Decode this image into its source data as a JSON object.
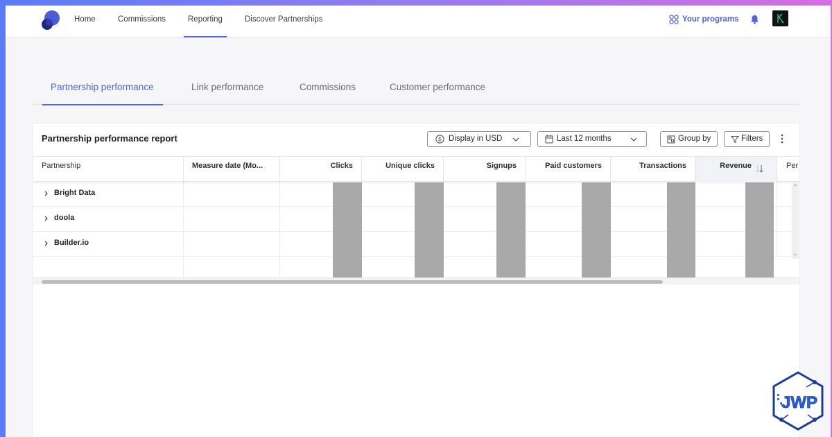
{
  "nav": {
    "links": [
      "Home",
      "Commissions",
      "Reporting",
      "Discover Partnerships"
    ],
    "active_index": 2,
    "programs_label": "Your programs"
  },
  "tabs": {
    "items": [
      "Partnership performance",
      "Link performance",
      "Commissions",
      "Customer performance"
    ],
    "active_index": 0
  },
  "report": {
    "title": "Partnership performance report",
    "currency_label": "Display in USD",
    "date_range_label": "Last 12 months",
    "group_by_label": "Group by",
    "filters_label": "Filters"
  },
  "table": {
    "columns": [
      "Partnership",
      "Measure date (Mo...",
      "Clicks",
      "Unique clicks",
      "Signups",
      "Paid customers",
      "Transactions",
      "Revenue",
      "Per"
    ],
    "sorted_column": "Revenue",
    "rows": [
      "Bright Data",
      "doola",
      "Builder.io"
    ]
  },
  "watermark": {
    "text": "JWP"
  },
  "colors": {
    "accent": "#5563d6",
    "redaction": "#a9a9a9",
    "background_gradient_start": "#5b7cf5",
    "background_gradient_end": "#d46fdf"
  }
}
